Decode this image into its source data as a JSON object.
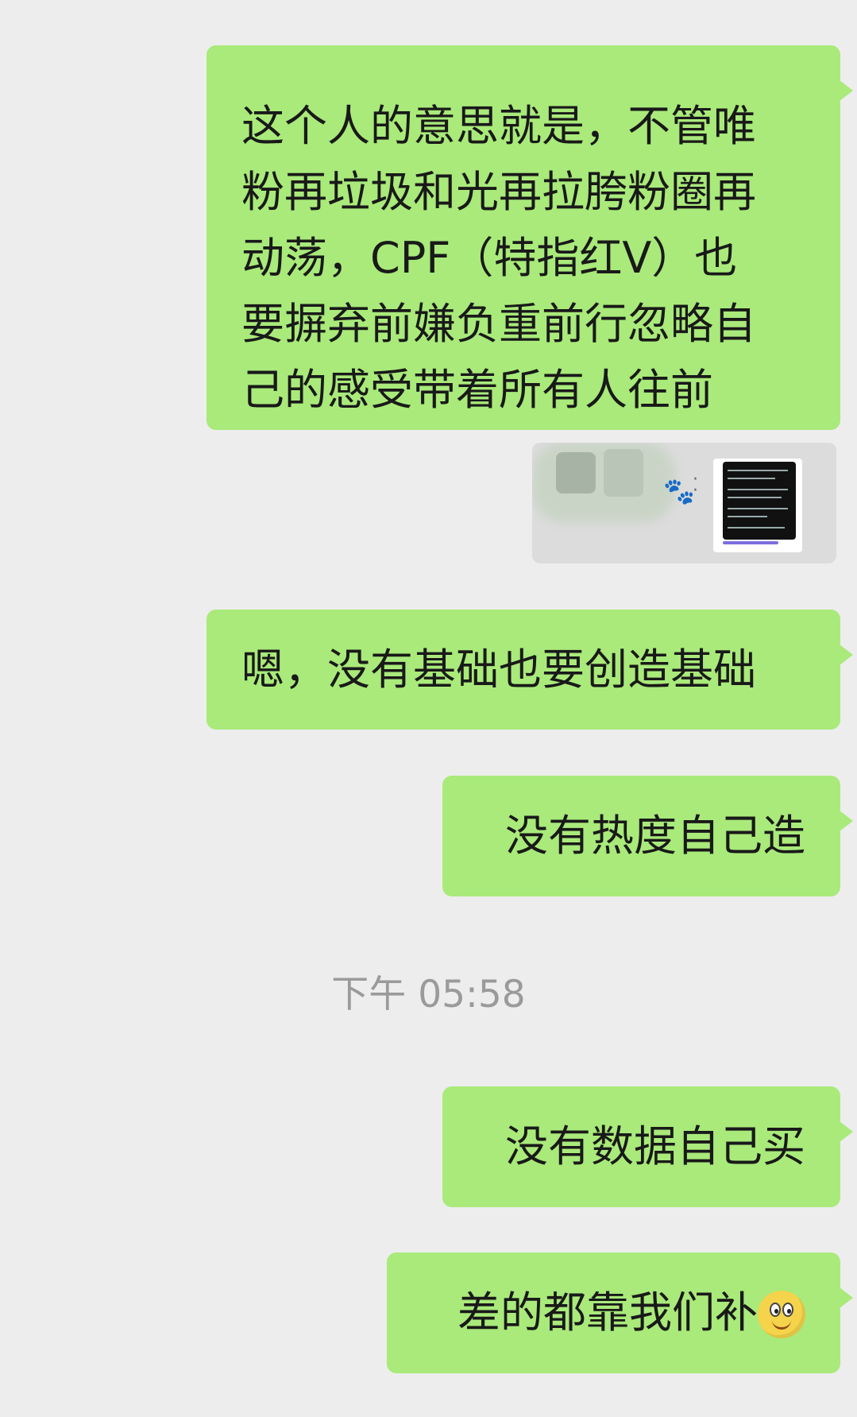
{
  "messages": {
    "m1_lines": [
      "这个人的意思就是，不管唯",
      "粉再垃圾和光再拉胯粉圈再",
      "动荡，CPF（特指红V）也",
      "要摒弃前嫌负重前行忽略自",
      "己的感受带着所有人往前"
    ],
    "m3": "嗯，没有基础也要创造基础",
    "m4": "没有热度自己造",
    "timestamp": "下午 05:58",
    "m5": "没有数据自己买",
    "m6": "差的都靠我们补"
  },
  "icons": {
    "paw": "paw-icon",
    "emoji": "smiley-emoji-icon"
  },
  "colors": {
    "background": "#ededed",
    "bubble_out": "#a9ea7a",
    "timestamp": "#9a9a9a"
  }
}
